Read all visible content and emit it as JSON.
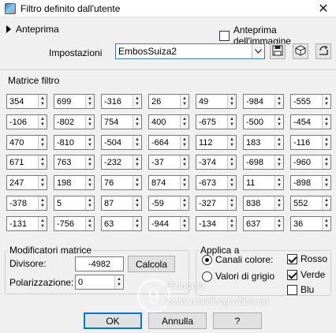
{
  "window": {
    "title": "Filtro definito dall'utente",
    "icon": "app-icon",
    "close_glyph": "✕"
  },
  "preview": {
    "label": "Anteprima",
    "image_preview_label": "Anteprima dell'immagine",
    "image_preview_checked": false
  },
  "settings": {
    "label": "Impostazioni",
    "preset_value": "EmbosSuiza2"
  },
  "matrix": {
    "label": "Matrice filtro",
    "rows": [
      [
        "354",
        "699",
        "-316",
        "26",
        "49",
        "-984",
        "-555"
      ],
      [
        "-106",
        "-802",
        "754",
        "400",
        "-675",
        "-500",
        "-454"
      ],
      [
        "470",
        "-810",
        "-504",
        "-664",
        "112",
        "183",
        "-116"
      ],
      [
        "671",
        "763",
        "-232",
        "-37",
        "-374",
        "-698",
        "-960"
      ],
      [
        "247",
        "198",
        "76",
        "874",
        "-673",
        "11",
        "-898"
      ],
      [
        "-378",
        "5",
        "87",
        "-59",
        "-327",
        "838",
        "552"
      ],
      [
        "-131",
        "-756",
        "63",
        "-944",
        "-134",
        "637",
        "36"
      ]
    ]
  },
  "modifiers": {
    "label": "Modificatori matrice",
    "divisor_label": "Divisore:",
    "divisor_value": "-4982",
    "compute_label": "Calcola",
    "bias_label": "Polarizzazione:",
    "bias_value": "0"
  },
  "apply_to": {
    "label": "Applica a",
    "color_channels_label": "Canali colore:",
    "grey_values_label": "Valori di grigio",
    "red_label": "Rosso",
    "green_label": "Verde",
    "blue_label": "Blu",
    "mode": "color-channels",
    "red_checked": true,
    "green_checked": true,
    "blue_checked": false
  },
  "buttons": {
    "ok_label": "OK",
    "cancel_label": "Annulla",
    "help_label": "?"
  },
  "watermark": {
    "line1": "Pinuccia",
    "line2": "www.maidiregrafica.eu"
  }
}
